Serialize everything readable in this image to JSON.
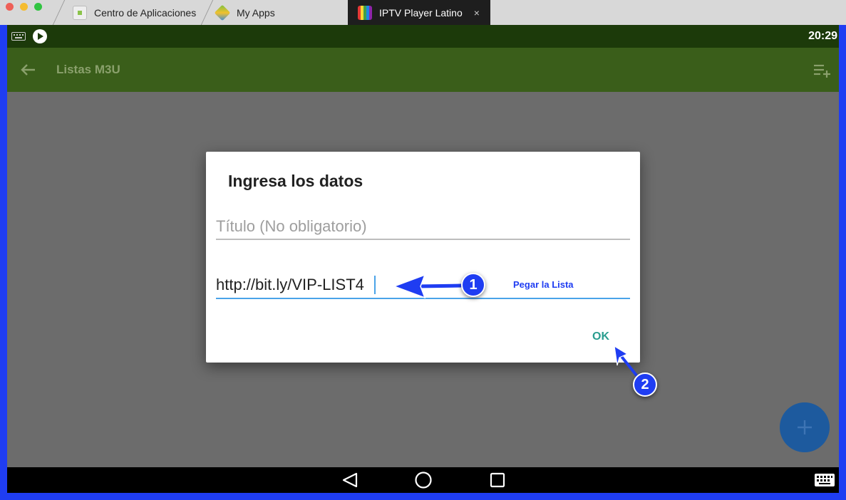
{
  "tabs": [
    {
      "label": "Centro de Aplicaciones"
    },
    {
      "label": "My Apps"
    },
    {
      "label": "IPTV Player Latino",
      "close": "×"
    }
  ],
  "status": {
    "time": "20:29"
  },
  "appbar": {
    "title": "Listas M3U"
  },
  "dialog": {
    "title": "Ingresa los datos",
    "title_field_placeholder": "Título (No obligatorio)",
    "url_field_value": "http://bit.ly/VIP-LIST4",
    "ok_label": "OK"
  },
  "annotations": {
    "paste_hint": "Pegar la Lista",
    "step1": "1",
    "step2": "2"
  },
  "colors": {
    "accent": "#1f3df2",
    "ok": "#2a9d8f",
    "appbar": "#3a5e1a"
  }
}
